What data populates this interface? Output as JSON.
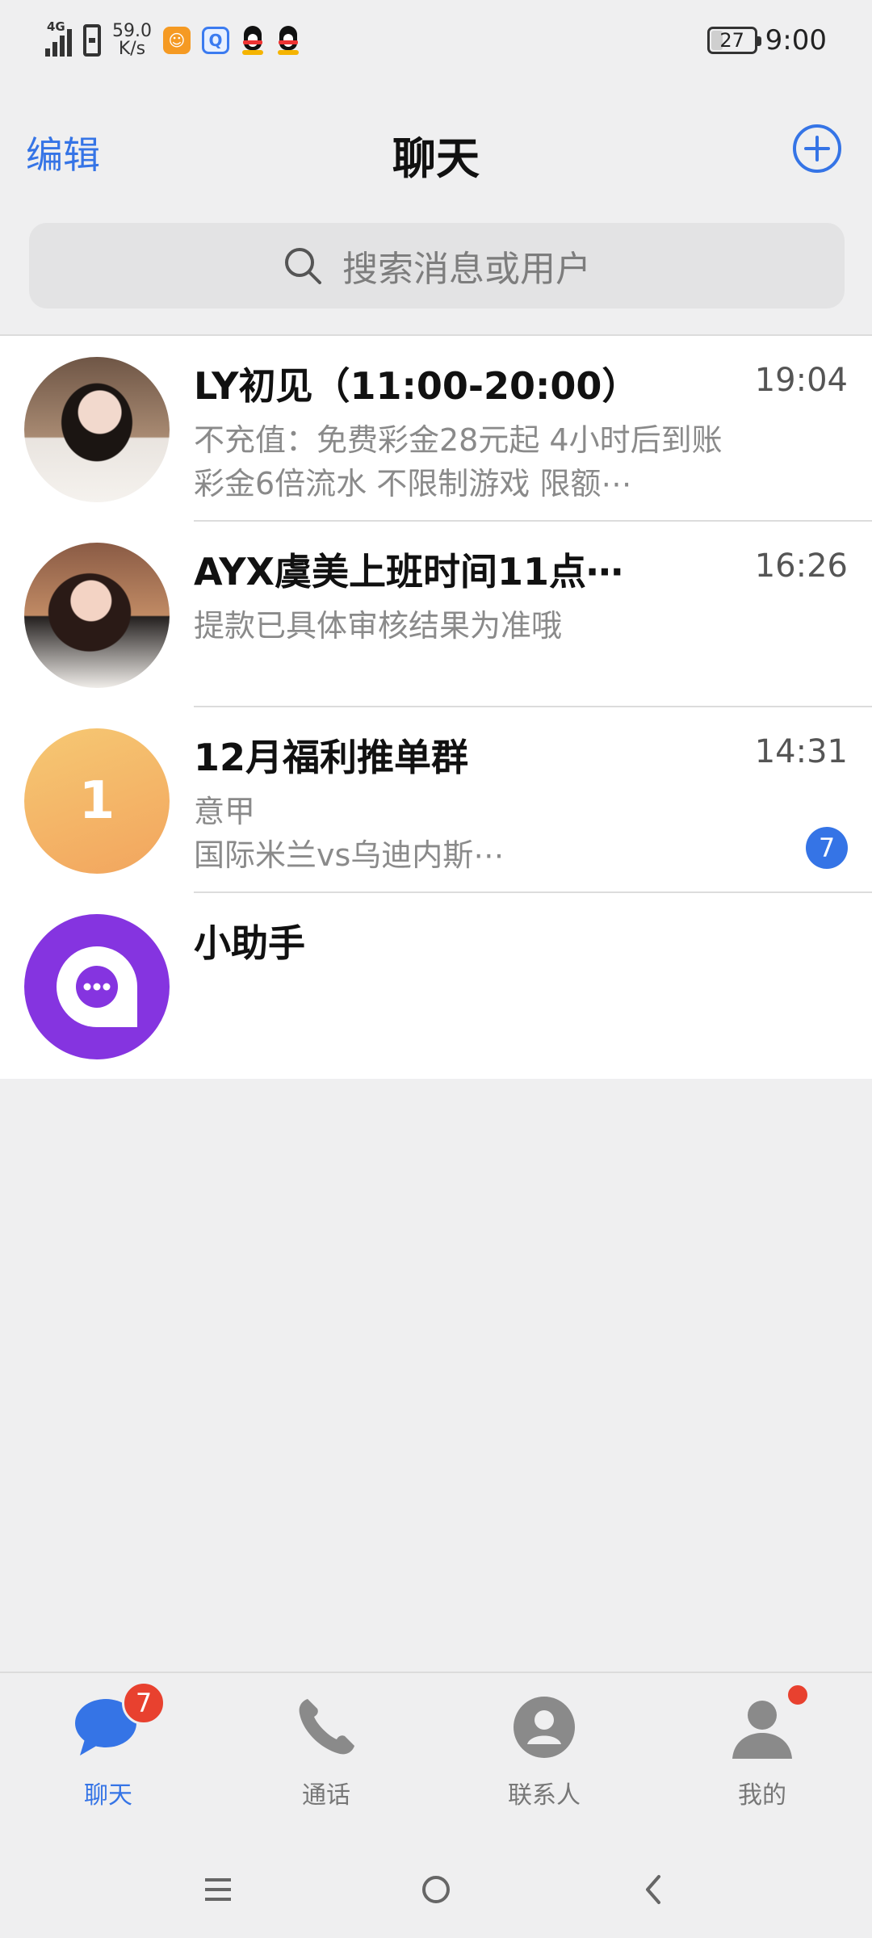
{
  "status_bar": {
    "network_label": "4G",
    "net_speed_value": "59.0",
    "net_speed_unit": "K/s",
    "battery": "27",
    "time": "9:00"
  },
  "header": {
    "edit_label": "编辑",
    "title": "聊天"
  },
  "search": {
    "placeholder": "搜索消息或用户"
  },
  "chats": [
    {
      "name": "LY初见（11:00-20:00）",
      "time": "19:04",
      "line1": "不充值：免费彩金28元起  4小时后到账",
      "line2": "彩金6倍流水 不限制游戏          限额⋯"
    },
    {
      "name": "AYX虞美上班时间11点⋯",
      "time": "16:26",
      "line1": "提款已具体审核结果为准哦",
      "line2": ""
    },
    {
      "name": "12月福利推单群",
      "time": "14:31",
      "avatar_text": "1",
      "line1": "意甲",
      "line2": "国际米兰vs乌迪内斯⋯",
      "unread": "7"
    },
    {
      "name": "小助手",
      "time": "",
      "line1": "",
      "line2": ""
    }
  ],
  "bottom_nav": [
    {
      "label": "聊天",
      "icon": "chat-bubble-icon",
      "badge": "7"
    },
    {
      "label": "通话",
      "icon": "phone-icon"
    },
    {
      "label": "联系人",
      "icon": "contact-icon"
    },
    {
      "label": "我的",
      "icon": "profile-icon"
    }
  ],
  "colors": {
    "accent": "#3574e6",
    "badge": "#e8412f",
    "background": "#efeff0"
  }
}
